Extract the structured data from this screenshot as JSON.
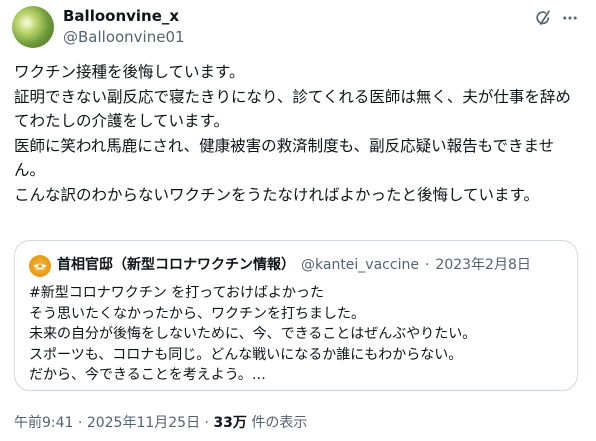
{
  "author": {
    "name": "Balloonvine_x",
    "handle": "@Balloonvine01"
  },
  "icons": {
    "grok": "grok-icon",
    "more": "more-options-icon"
  },
  "body_text": "ワクチン接種を後悔しています。\n証明できない副反応で寝たきりになり、診てくれる医師は無く、夫が仕事を辞めてわたしの介護をしています。\n医師に笑われ馬鹿にされ、健康被害の救済制度も、副反応疑い報告もできません。\nこんな訳のわからないワクチンをうたなければよかったと後悔しています。",
  "quote": {
    "name": "首相官邸（新型コロナワクチン情報）",
    "handle": "@kantei_vaccine",
    "separator": "·",
    "date": "2023年2月8日",
    "text": "#新型コロナワクチン を打っておけばよかった\nそう思いたくなかったから、ワクチンを打ちました。\n未来の自分が後悔をしないために、今、できることはぜんぶやりたい。\nスポーツも、コロナも同じ。どんな戦いになるか誰にもわからない。\nだから、今できることを考えよう。…"
  },
  "footer": {
    "time": "午前9:41",
    "separator": "·",
    "date": "2025年11月25日",
    "views": "33万",
    "views_label": "件の表示"
  }
}
